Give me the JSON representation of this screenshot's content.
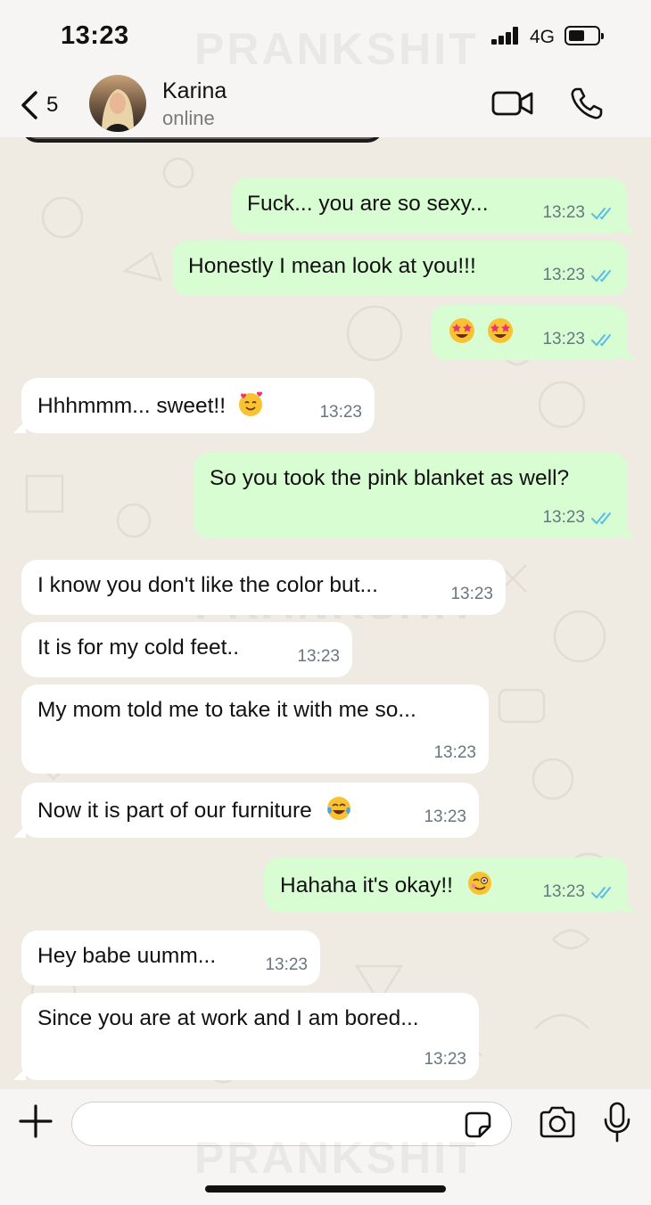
{
  "status_bar": {
    "time": "13:23",
    "network": "4G",
    "watermark": "PRANKSHIT"
  },
  "header": {
    "back_count": "5",
    "contact_name": "Karina",
    "contact_status": "online"
  },
  "messages": [
    {
      "direction": "out",
      "text": "Fuck... you are so sexy...",
      "time": "13:23",
      "read": true
    },
    {
      "direction": "out",
      "text": "Honestly I mean look at you!!!",
      "time": "13:23",
      "read": true
    },
    {
      "direction": "out",
      "text": "",
      "emoji": [
        "star-struck-emoji",
        "star-struck-emoji"
      ],
      "time": "13:23",
      "read": true
    },
    {
      "direction": "in",
      "text": "Hhhmmm... sweet!!",
      "emoji": [
        "smiling-face-with-hearts-emoji"
      ],
      "time": "13:23"
    },
    {
      "direction": "out",
      "text": "So you took the pink blanket as well?",
      "time": "13:23",
      "read": true
    },
    {
      "direction": "in",
      "text": "I know you don't like the color but...",
      "time": "13:23"
    },
    {
      "direction": "in",
      "text": "It is for my cold feet..",
      "time": "13:23"
    },
    {
      "direction": "in",
      "text": "My mom told me to take it with me so...",
      "time": "13:23"
    },
    {
      "direction": "in",
      "text": "Now it is part of our furniture",
      "emoji": [
        "tears-of-joy-emoji"
      ],
      "time": "13:23"
    },
    {
      "direction": "out",
      "text": "Hahaha it's okay!!",
      "emoji": [
        "winking-face-emoji"
      ],
      "time": "13:23",
      "read": true
    },
    {
      "direction": "in",
      "text": "Hey babe uumm...",
      "time": "13:23"
    },
    {
      "direction": "in",
      "text": "Since you are at work and I am bored...",
      "time": "13:23"
    }
  ],
  "input": {
    "placeholder": "",
    "value": ""
  },
  "colors": {
    "outgoing_bubble": "#d9fdd3",
    "incoming_bubble": "#ffffff",
    "chat_background": "#efeae2",
    "read_ticks": "#53bdeb",
    "timestamp": "#667781"
  }
}
